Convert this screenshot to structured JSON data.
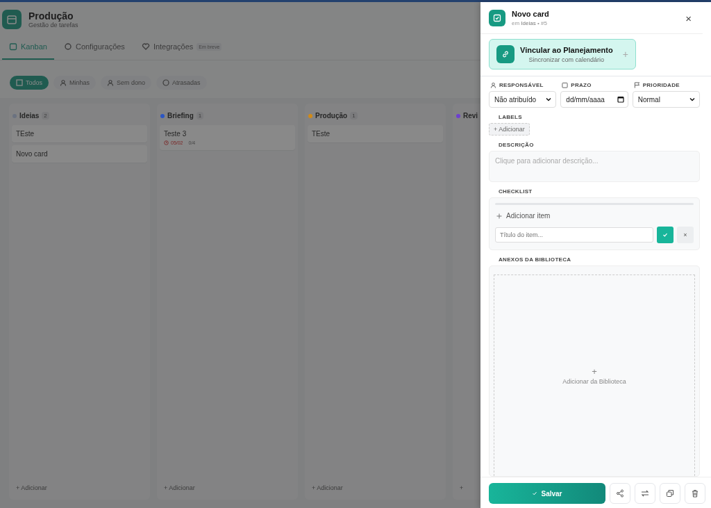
{
  "app": {
    "title": "Produção",
    "subtitle": "Gestão de tarefas"
  },
  "tabs": [
    {
      "label": "Kanban",
      "selected": true
    },
    {
      "label": "Configurações",
      "selected": false
    },
    {
      "label": "Integrações",
      "selected": false,
      "badge": "Em breve"
    }
  ],
  "filters": [
    {
      "label": "Todos",
      "selected": true
    },
    {
      "label": "Minhas",
      "selected": false
    },
    {
      "label": "Sem dono",
      "selected": false
    },
    {
      "label": "Atrasadas",
      "selected": false
    }
  ],
  "columns": [
    {
      "name": "Ideias",
      "count": "2",
      "color": "#6b7280",
      "cards": [
        {
          "title": "TEste"
        },
        {
          "title": "Novo card"
        }
      ],
      "add": "+ Adicionar"
    },
    {
      "name": "Briefing",
      "count": "1",
      "color": "#2b56c4",
      "cards": [
        {
          "title": "Teste 3",
          "due": "05/02",
          "checklist": "0/4"
        }
      ],
      "add": "+ Adicionar"
    },
    {
      "name": "Produção",
      "count": "1",
      "color": "#d18a16",
      "cards": [
        {
          "title": "TEste"
        }
      ],
      "add": "+ Adicionar"
    },
    {
      "name": "Revi",
      "color": "#6d3fd0",
      "add": "+"
    }
  ],
  "panel": {
    "title": "Novo card",
    "subtitle": "em **Ideias** • #5",
    "close": "×",
    "link": {
      "title": "Vincular ao Planejamento",
      "subtitle": "Sincronizar com calendário",
      "plus": "+"
    },
    "fields": [
      {
        "label": "RESPONSÁVEL",
        "kind": "select",
        "value": "Não atribuído"
      },
      {
        "label": "PRAZO",
        "kind": "date",
        "value": "dd/mm/aaaa"
      },
      {
        "label": "PRIORIDADE",
        "kind": "select",
        "value": "Normal"
      }
    ],
    "labels": {
      "label": "LABELS",
      "add": "+ Adicionar"
    },
    "description": {
      "label": "DESCRIÇÃO",
      "placeholder": "Clique para adicionar descrição..."
    },
    "checklist": {
      "label": "CHECKLIST",
      "level": 0,
      "add": "Adicionar item",
      "placeholder": "Título do item...",
      "cancel": "×"
    },
    "attachments": {
      "label": "ANEXOS DA BIBLIOTECA",
      "plus": "+",
      "add": "Adicionar da Biblioteca"
    },
    "save": "Salvar"
  }
}
